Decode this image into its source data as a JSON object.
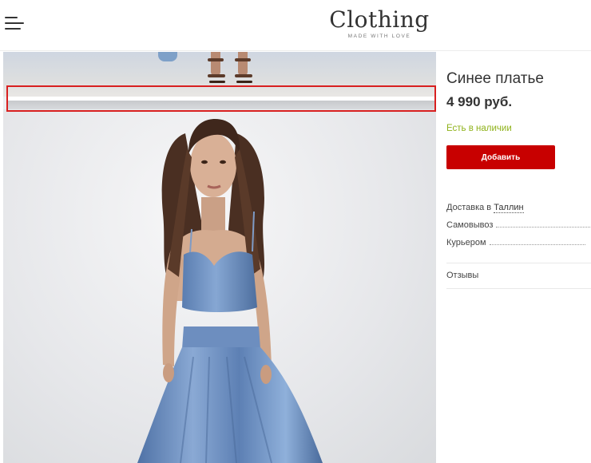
{
  "header": {
    "logo_title": "Clothing",
    "logo_tagline": "MADE WITH LOVE",
    "menu_icon": "hamburger-menu-icon"
  },
  "product": {
    "name": "Синее платье",
    "price": "4 990 руб.",
    "stock_status": "Есть в наличии",
    "add_button_label": "Добавить"
  },
  "delivery": {
    "label": "Доставка в ",
    "city": "Таллин",
    "options": [
      {
        "label": "Самовывоз"
      },
      {
        "label": "Курьером"
      }
    ]
  },
  "tabs": {
    "reviews_label": "Отзывы"
  },
  "colors": {
    "accent": "#c80000",
    "in_stock": "#8fb21a",
    "highlight": "#d82020",
    "dress": "#6f92c2"
  }
}
